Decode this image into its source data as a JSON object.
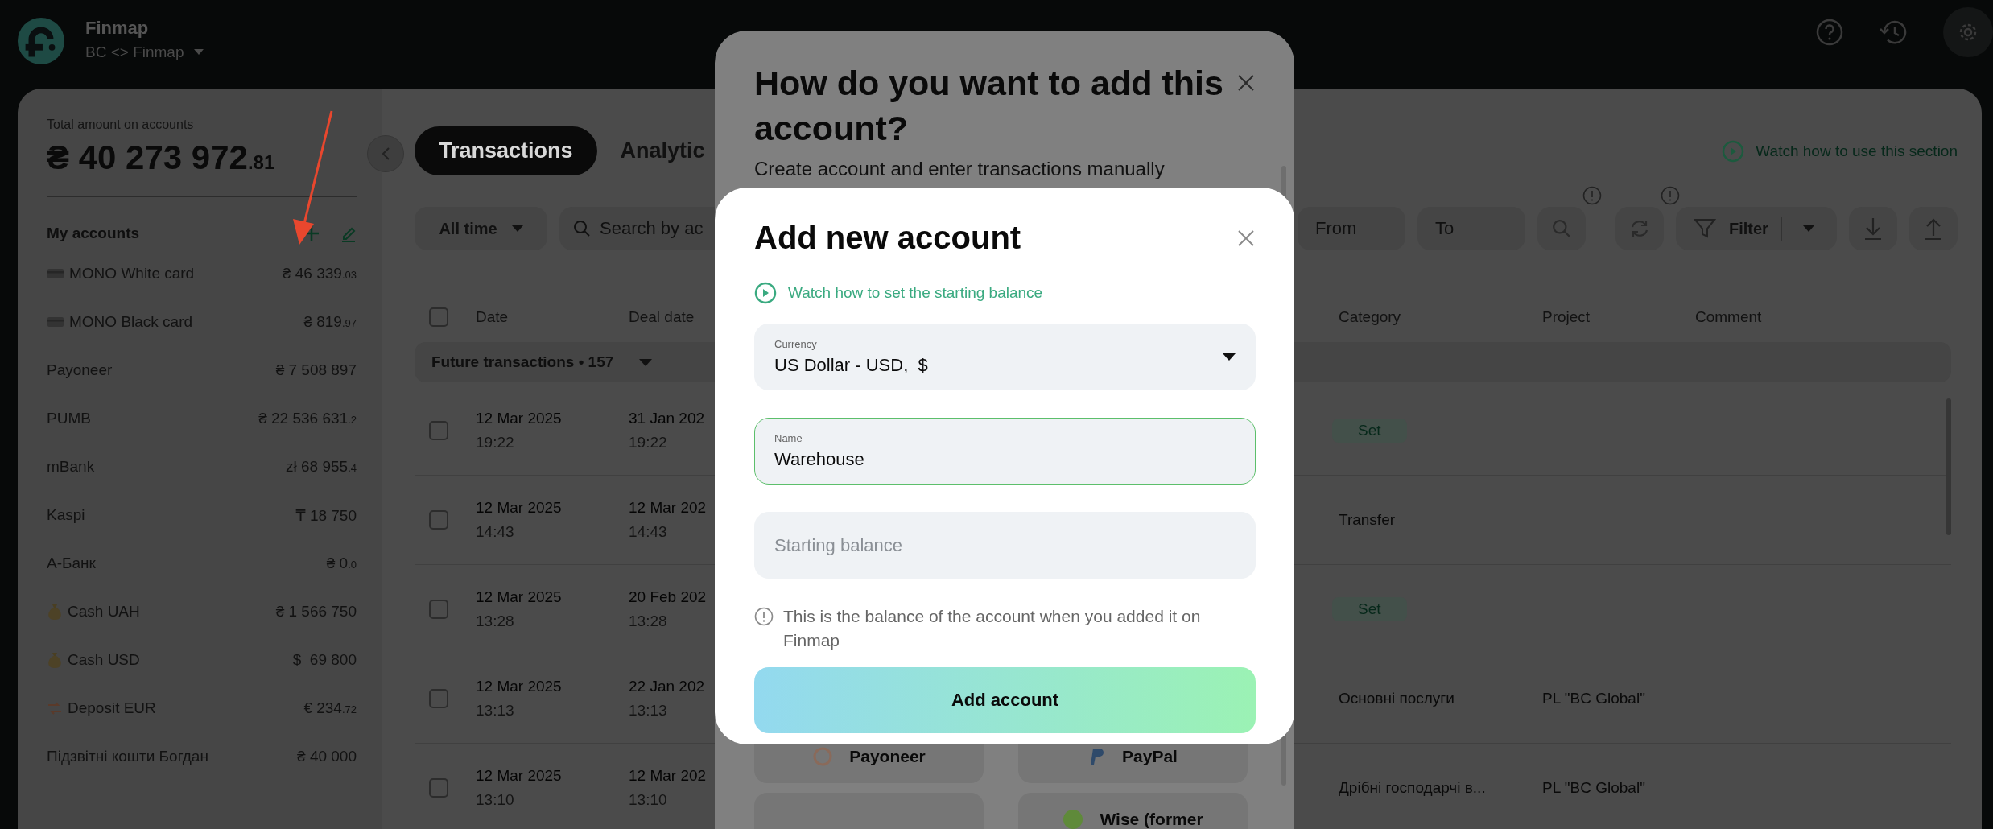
{
  "app": {
    "name": "Finmap",
    "workspace": "BC <> Finmap"
  },
  "sidebar": {
    "total_label": "Total amount on accounts",
    "total_amount": "₴ 40 273 972",
    "total_fraction": ".81",
    "accounts_title": "My accounts",
    "accounts": [
      {
        "kind": "card",
        "name": "MONO White card",
        "amount": "₴ 46 339",
        "fraction": ".03"
      },
      {
        "kind": "card",
        "name": "MONO Black card",
        "amount": "₴ 819",
        "fraction": ".97"
      },
      {
        "name": "Payoneer",
        "amount": "₴ 7 508 897"
      },
      {
        "name": "PUMB",
        "amount": "₴ 22 536 631",
        "fraction": ".2"
      },
      {
        "name": "mBank",
        "amount": "zł 68 955",
        "fraction": ".4"
      },
      {
        "name": "Kaspi",
        "amount": "₸ 18 750"
      },
      {
        "name": "А-Банк",
        "amount": "₴ 0",
        "fraction": ".0"
      },
      {
        "kind": "moneybag",
        "name": "Cash UAH",
        "amount": "₴ 1 566 750"
      },
      {
        "kind": "moneybag",
        "name": "Cash USD",
        "amount": "$  69 800"
      },
      {
        "kind": "exchange",
        "name": "Deposit EUR",
        "amount": "€ 234",
        "fraction": ".72"
      },
      {
        "name": "Підзвітні кошти Богдан",
        "amount": "₴ 40 000"
      }
    ]
  },
  "tabs": [
    {
      "label": "Transactions",
      "selected": true
    },
    {
      "label": "Analytic",
      "selected": false
    }
  ],
  "watch_link": "Watch how to use this section",
  "toolbar": {
    "period": "All time",
    "search_placeholder": "Search by ac",
    "from_placeholder": "From",
    "to_placeholder": "To",
    "filter": "Filter"
  },
  "table": {
    "header_checked": false,
    "columns": [
      "Date",
      "Deal date",
      "Category",
      "Project",
      "Comment"
    ],
    "group": "Future transactions • 157",
    "rows": [
      {
        "checked": false,
        "date": "12 Mar 2025",
        "time": "19:22",
        "deal_date": "31 Jan 202",
        "deal_time": "19:22",
        "category": {
          "kind": "badge",
          "text": "Set"
        }
      },
      {
        "checked": false,
        "date": "12 Mar 2025",
        "time": "14:43",
        "deal_date": "12 Mar 202",
        "deal_time": "14:43",
        "category": {
          "kind": "text",
          "text": "Transfer"
        }
      },
      {
        "checked": false,
        "date": "12 Mar 2025",
        "time": "13:28",
        "deal_date": "20 Feb 202",
        "deal_time": "13:28",
        "category": {
          "kind": "badge",
          "text": "Set"
        }
      },
      {
        "checked": false,
        "date": "12 Mar 2025",
        "time": "13:13",
        "deal_date": "22 Jan 202",
        "deal_time": "13:13",
        "category": {
          "kind": "text",
          "text": "Основні послуги"
        },
        "project": "PL \"BC Global\""
      },
      {
        "checked": false,
        "date": "12 Mar 2025",
        "time": "13:10",
        "deal_date": "12 Mar 202",
        "deal_time": "13:10",
        "category": {
          "kind": "text",
          "text": "Дрібні господарчі в..."
        },
        "project": "PL \"BC Global\""
      }
    ]
  },
  "back_dialog": {
    "title": "How do you want to add this account?",
    "subtitle": "Create account and enter transactions manually",
    "options": [
      {
        "kind": "payoneer",
        "name": "Payoneer"
      },
      {
        "kind": "paypal",
        "name": "PayPal"
      },
      {
        "kind": "blank"
      },
      {
        "kind": "wise",
        "name": "Wise (former"
      }
    ]
  },
  "dialog": {
    "title": "Add new account",
    "watch_link": "Watch how to set the starting balance",
    "currency": {
      "label": "Currency",
      "value": "US Dollar - USD,  $"
    },
    "name": {
      "label": "Name",
      "value": "Warehouse",
      "focused": true
    },
    "balance": {
      "placeholder": "Starting balance"
    },
    "note": "This is the balance of the account when you added it on Finmap",
    "button": "Add account"
  }
}
